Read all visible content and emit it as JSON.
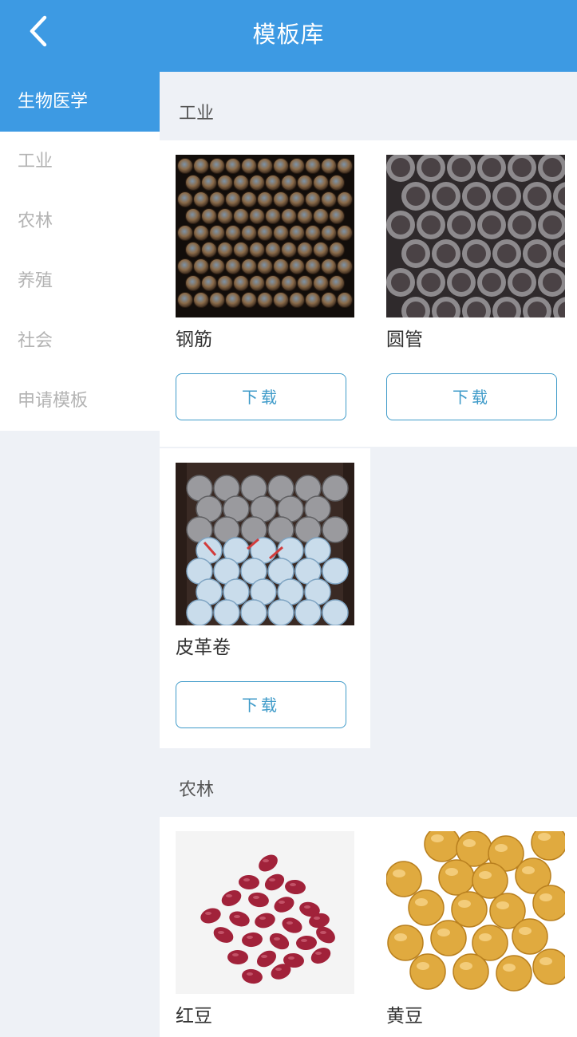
{
  "header": {
    "title": "模板库",
    "back_icon": "chevron-left-icon"
  },
  "sidebar": {
    "items": [
      {
        "label": "生物医学",
        "active": true
      },
      {
        "label": "工业",
        "active": false
      },
      {
        "label": "农林",
        "active": false
      },
      {
        "label": "养殖",
        "active": false
      },
      {
        "label": "社会",
        "active": false
      },
      {
        "label": "申请模板",
        "active": false
      }
    ]
  },
  "sections": [
    {
      "title": "工业",
      "items": [
        {
          "name": "钢筋",
          "image": "rebar-bundle-photo",
          "button": "下载"
        },
        {
          "name": "圆管",
          "image": "round-pipes-photo",
          "button": "下载"
        },
        {
          "name": "皮革卷",
          "image": "leather-rolls-photo",
          "button": "下载"
        }
      ]
    },
    {
      "title": "农林",
      "items": [
        {
          "name": "红豆",
          "image": "red-beans-photo"
        },
        {
          "name": "黄豆",
          "image": "soybeans-photo"
        }
      ]
    }
  ],
  "colors": {
    "primary": "#3d9ae3",
    "button_border": "#3f9bc9",
    "background": "#eef1f6",
    "sidebar_inactive_text": "#b3b3b3"
  }
}
